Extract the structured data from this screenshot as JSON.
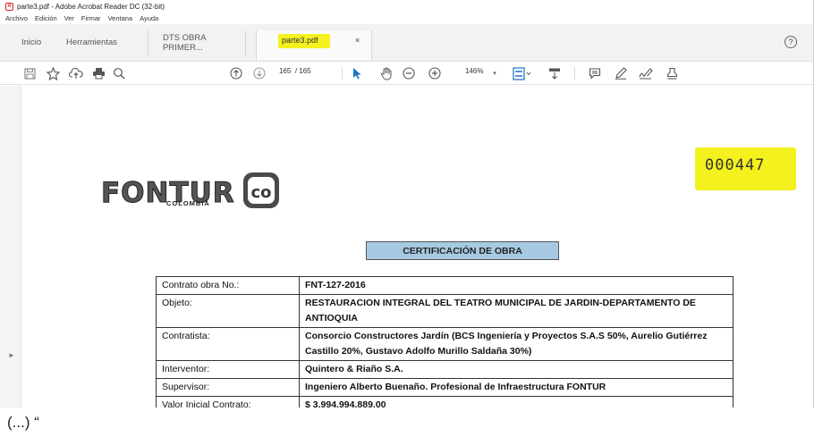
{
  "window": {
    "title": "parte3.pdf - Adobe Acrobat Reader DC (32-bit)"
  },
  "menu": [
    "Archivo",
    "Edición",
    "Ver",
    "Firmar",
    "Ventana",
    "Ayuda"
  ],
  "tabs": {
    "home": "Inicio",
    "tools": "Herramientas",
    "doc1": "DTS OBRA PRIMER...",
    "active": "parte3.pdf",
    "close": "×"
  },
  "toolbar": {
    "page_current": "165",
    "page_total": "/ 165",
    "zoom": "146%"
  },
  "document": {
    "logo_main": "FONTUR",
    "logo_sub": "COLOMBIA",
    "logo_badge": "co",
    "stamp_number": "000447",
    "cert_title": "CERTIFICACIÓN DE OBRA",
    "rows": [
      {
        "key": "Contrato obra No.:",
        "value": "FNT-127-2016"
      },
      {
        "key": "Objeto:",
        "value": "RESTAURACION INTEGRAL DEL TEATRO MUNICIPAL DE JARDIN-DEPARTAMENTO DE ANTIOQUIA"
      },
      {
        "key": "Contratista:",
        "value": "Consorcio Constructores Jardín (BCS Ingeniería y Proyectos S.A.S 50%, Aurelio Gutiérrez Castillo 20%, Gustavo Adolfo Murillo Saldaña 30%)"
      },
      {
        "key": "Interventor:",
        "value": "Quintero & Riaño S.A."
      },
      {
        "key": "Supervisor:",
        "value": "Ingeniero Alberto Buenaño. Profesional de Infraestructura FONTUR"
      },
      {
        "key": "Valor Inicial Contrato:",
        "value": "$ 3.994.994.889,00"
      }
    ]
  },
  "footer": "(...) “",
  "colors": {
    "highlight": "#f4f11e",
    "cert_title_bg": "#a7cae3",
    "toolbar_icon": "#5a5a5a"
  }
}
